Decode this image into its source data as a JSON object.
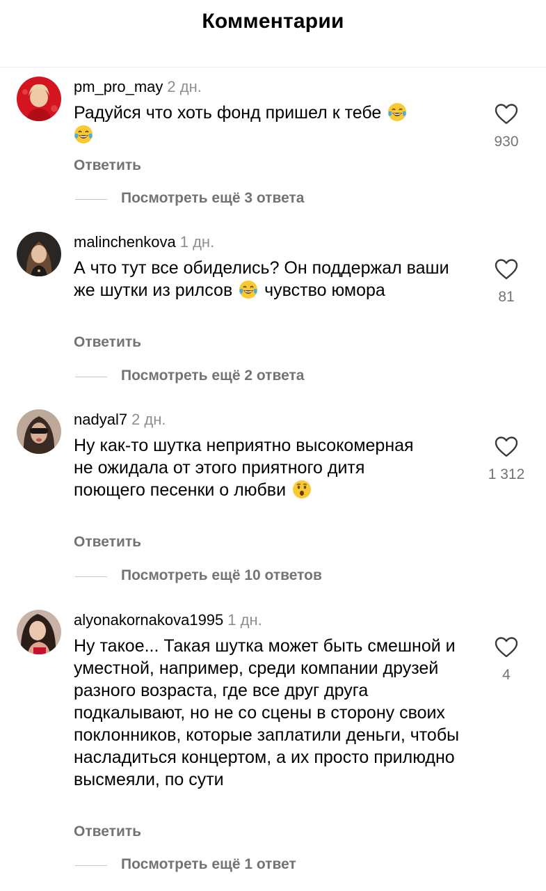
{
  "header": {
    "title": "Комментарии"
  },
  "comments": [
    {
      "username": "pm_pro_may",
      "time": "2 дн.",
      "text_before_emoji": "Радуйся что хоть фонд пришел к тебе",
      "emojis": [
        "face-with-tears-of-joy",
        "face-with-tears-of-joy"
      ],
      "likes": "930",
      "reply_label": "Ответить",
      "view_replies": "Посмотреть ещё 3 ответа"
    },
    {
      "username": "malinchenkova",
      "time": "1 дн.",
      "text_part1": "А что тут все обиделись? Он поддержал ваши же шутки из рилсов",
      "emoji": "face-with-tears-of-joy",
      "text_part2": "чувство юмора",
      "likes": "81",
      "reply_label": "Ответить",
      "view_replies": "Посмотреть ещё 2 ответа"
    },
    {
      "username": "nadyal7",
      "time": "2 дн.",
      "text_before_emoji": "Ну как-то шутка неприятно высокомерная не ожидала от этого приятного дитя поющего песенки о любви",
      "emoji": "hushed-face",
      "likes": "1 312",
      "reply_label": "Ответить",
      "view_replies": "Посмотреть ещё 10 ответов"
    },
    {
      "username": "alyonakornakova1995",
      "time": "1 дн.",
      "text": "Ну такое... Такая шутка может быть смешной и уместной, например, среди компании друзей разного возраста, где все друг друга подкалывают, но не со сцены в сторону своих поклонников, которые заплатили деньги, чтобы насладиться концертом, а их просто прилюдно высмеяли, по сути",
      "likes": "4",
      "reply_label": "Ответить",
      "view_replies": "Посмотреть ещё 1 ответ"
    }
  ],
  "icons": {
    "like": "heart-outline-icon"
  },
  "colors": {
    "secondary_text": "#737373",
    "timestamp": "#8e8e8e",
    "divider": "#c7c7c7"
  }
}
